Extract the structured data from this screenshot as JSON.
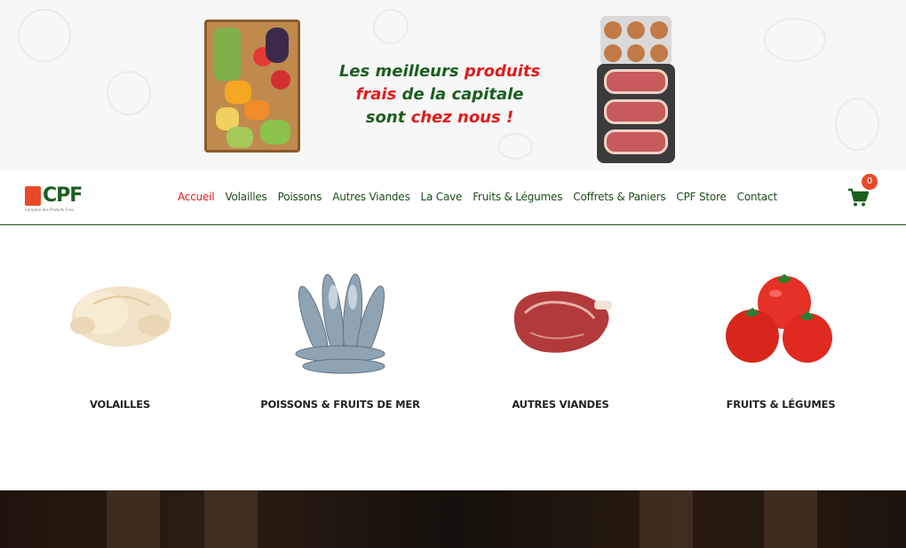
{
  "hero": {
    "tagline_line1_a": "Les meilleurs ",
    "tagline_line1_b": "produits",
    "tagline_line2_a": "frais",
    "tagline_line2_b": " de la capitale",
    "tagline_line3_a": "sont ",
    "tagline_line3_b": "chez nous",
    "tagline_line3_c": " !"
  },
  "logo": {
    "text": "CPF",
    "subtitle": "Comptoir des Produits Frais"
  },
  "nav": {
    "items": [
      {
        "label": "Accueil",
        "active": true
      },
      {
        "label": "Volailles"
      },
      {
        "label": "Poissons"
      },
      {
        "label": "Autres Viandes"
      },
      {
        "label": "La Cave"
      },
      {
        "label": "Fruits & Légumes"
      },
      {
        "label": "Coffrets & Paniers"
      },
      {
        "label": "CPF Store"
      },
      {
        "label": "Contact"
      }
    ]
  },
  "cart": {
    "count": "0",
    "icon": "cart-icon"
  },
  "categories": [
    {
      "label": "VOLAILLES",
      "icon": "chicken-image"
    },
    {
      "label": "POISSONS & FRUITS DE MER",
      "icon": "fish-image"
    },
    {
      "label": "AUTRES VIANDES",
      "icon": "meat-image"
    },
    {
      "label": "FRUITS & LÉGUMES",
      "icon": "tomato-image"
    }
  ],
  "colors": {
    "brand_green": "#1b5e20",
    "accent_red": "#e21b1b",
    "badge_orange": "#e84a27"
  }
}
